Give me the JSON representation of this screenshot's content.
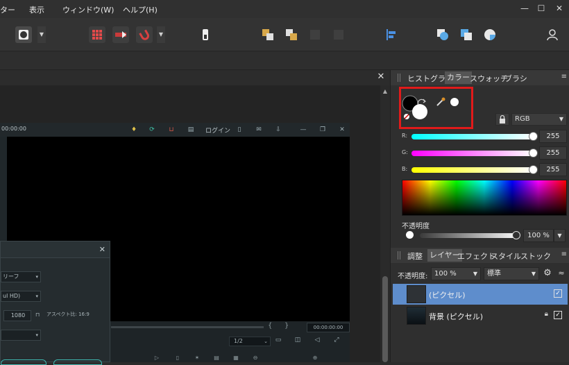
{
  "menubar": {
    "items": [
      "ター",
      "表示",
      "ウィンドウ(W)",
      "ヘルプ(H)"
    ]
  },
  "window_controls": {
    "minimize": "—",
    "maximize": "☐",
    "close": "✕"
  },
  "document": {
    "close_label": "✕"
  },
  "embedded_app": {
    "time": "00:00:00",
    "login_label": "ログイン",
    "window_minimize": "—",
    "window_close": "✕",
    "timecode": "00:00:00:00",
    "brace_left": "{",
    "brace_right": "}",
    "zoom_select": "1/2",
    "dialog": {
      "close": "✕",
      "field1": "リーフ",
      "field2": "ul HD)",
      "field3": "1080",
      "aspect_label": "アスペクト比: 16:9"
    }
  },
  "color_panel": {
    "tabs": [
      "ヒストグラム",
      "カラー",
      "スウォッチ",
      "ブラシ"
    ],
    "active_tab": "カラー",
    "menu_icon": "≡",
    "mode": "RGB",
    "sliders": [
      {
        "label": "R:",
        "value": "255",
        "fraction": 1.0,
        "gradient": "linear-gradient(to right, #00ffff, #ffffff)"
      },
      {
        "label": "G:",
        "value": "255",
        "fraction": 1.0,
        "gradient": "linear-gradient(to right, #ff00ff, #ffffff)"
      },
      {
        "label": "B:",
        "value": "255",
        "fraction": 1.0,
        "gradient": "linear-gradient(to right, #ffff00, #ffffff)"
      }
    ],
    "opacity_label": "不透明度",
    "opacity_value": "100 %",
    "opacity_fraction": 1.0,
    "highlight_color": "#e11a1a"
  },
  "layers_panel": {
    "tabs": [
      "調整",
      "レイヤー",
      "エフェクト",
      "スタイル",
      "ストック"
    ],
    "active_tab": "レイヤー",
    "opacity_label": "不透明度:",
    "opacity_value": "100 %",
    "blend_mode": "標準",
    "rows": [
      {
        "name": "(ピクセル)",
        "selected": true
      },
      {
        "name": "背景 (ピクセル)",
        "selected": false
      }
    ],
    "selected_color": "#5e8dcc"
  }
}
